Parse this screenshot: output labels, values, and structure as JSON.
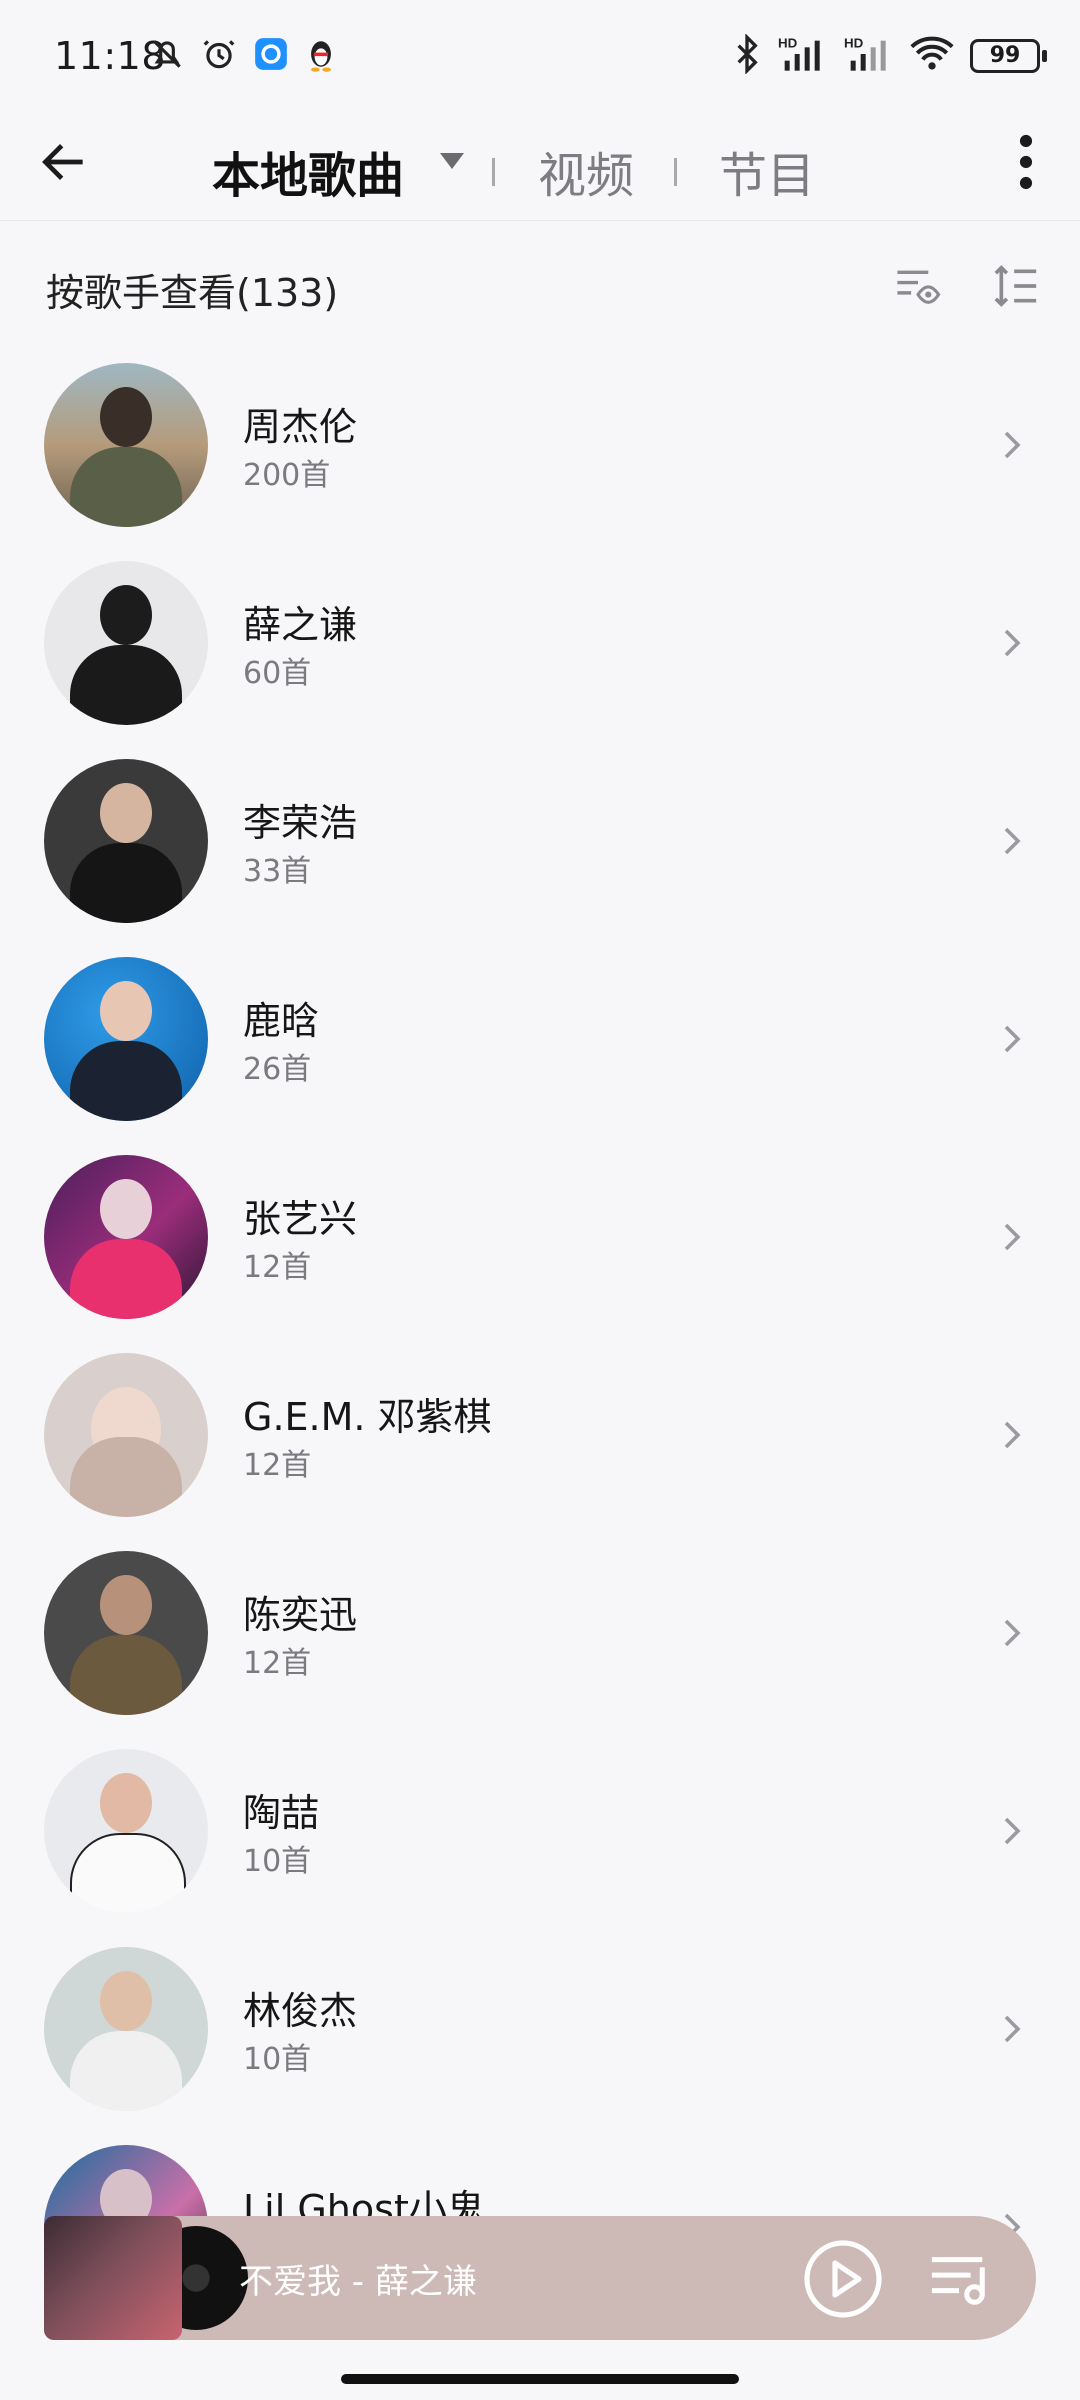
{
  "status_bar": {
    "time": "11:18",
    "left_icons": [
      "bell-off-icon",
      "alarm-icon",
      "browser-app-icon",
      "qq-penguin-icon"
    ],
    "right_icons": [
      "bluetooth-icon",
      "hd-signal-icon",
      "hd-signal-icon",
      "wifi-icon"
    ],
    "battery": "99"
  },
  "nav": {
    "back_icon": "back-arrow-icon",
    "tabs": [
      {
        "label": "本地歌曲",
        "active": true
      },
      {
        "label": "视频",
        "active": false
      },
      {
        "label": "节目",
        "active": false
      }
    ],
    "more_icon": "more-vertical-icon"
  },
  "list_header": {
    "title": "按歌手查看(133)",
    "filter_icon": "filter-eye-icon",
    "sort_icon": "sort-icon"
  },
  "artists": [
    {
      "name": "周杰伦",
      "count": "200首"
    },
    {
      "name": "薛之谦",
      "count": "60首"
    },
    {
      "name": "李荣浩",
      "count": "33首"
    },
    {
      "name": "鹿晗",
      "count": "26首"
    },
    {
      "name": "张艺兴",
      "count": "12首"
    },
    {
      "name": "G.E.M. 邓紫棋",
      "count": "12首"
    },
    {
      "name": "陈奕迅",
      "count": "12首"
    },
    {
      "name": "陶喆",
      "count": "10首"
    },
    {
      "name": "林俊杰",
      "count": "10首"
    },
    {
      "name": "Lil Ghost小鬼",
      "count": ""
    }
  ],
  "mini_player": {
    "now_playing": "不爱我 - 薛之谦",
    "play_icon": "play-circle-icon",
    "queue_icon": "playlist-icon"
  },
  "colors": {
    "background": "#f7f7f9",
    "mini_player": "#cdb9b6",
    "secondary_text": "#7a7a80"
  }
}
